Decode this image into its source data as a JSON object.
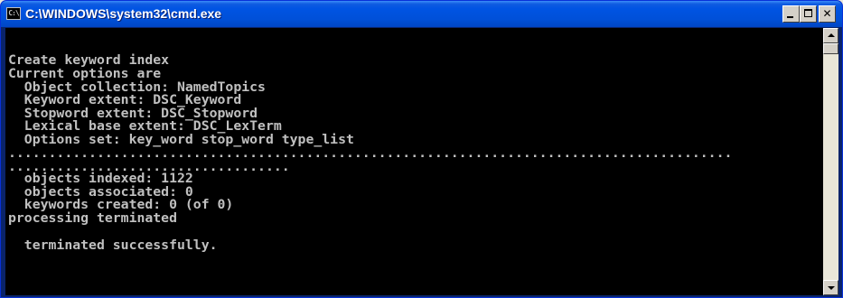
{
  "window": {
    "title": "C:\\WINDOWS\\system32\\cmd.exe",
    "icon_label": "C:\\",
    "controls": {
      "minimize_icon": "minimize-icon",
      "maximize_icon": "maximize-icon",
      "close_icon": "close-icon",
      "close_symbol": "✕"
    }
  },
  "console": {
    "lines": [
      "Create keyword index",
      "Current options are",
      "  Object collection: NamedTopics",
      "  Keyword extent: DSC_Keyword",
      "  Stopword extent: DSC_Stopword",
      "  Lexical base extent: DSC_LexTerm",
      "  Options set: key_word stop_word type_list",
      "..........................................................................................",
      "...................................",
      "  objects indexed: 1122",
      "  objects associated: 0",
      "  keywords created: 0 (of 0)",
      "processing terminated",
      "",
      "  terminated successfully."
    ]
  },
  "colors": {
    "titlebar": "#0054e3",
    "console_bg": "#000000",
    "console_text": "#c0c0c0"
  }
}
